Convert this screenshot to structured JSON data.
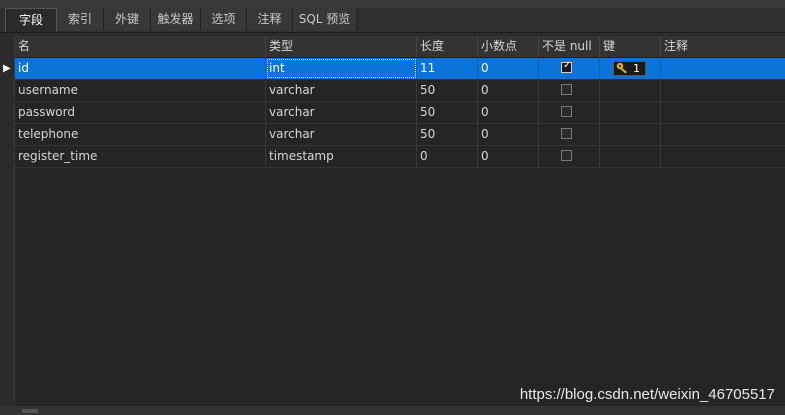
{
  "tabs": [
    {
      "label": "字段",
      "active": true
    },
    {
      "label": "索引",
      "active": false
    },
    {
      "label": "外键",
      "active": false
    },
    {
      "label": "触发器",
      "active": false
    },
    {
      "label": "选项",
      "active": false
    },
    {
      "label": "注释",
      "active": false
    },
    {
      "label": "SQL 预览",
      "active": false
    }
  ],
  "columns": [
    "名",
    "类型",
    "长度",
    "小数点",
    "不是 null",
    "键",
    "注释"
  ],
  "rows": [
    {
      "name": "id",
      "type": "int",
      "length": "11",
      "decimals": "0",
      "not_null": true,
      "key": "1",
      "comment": ""
    },
    {
      "name": "username",
      "type": "varchar",
      "length": "50",
      "decimals": "0",
      "not_null": false,
      "key": "",
      "comment": ""
    },
    {
      "name": "password",
      "type": "varchar",
      "length": "50",
      "decimals": "0",
      "not_null": false,
      "key": "",
      "comment": ""
    },
    {
      "name": "telephone",
      "type": "varchar",
      "length": "50",
      "decimals": "0",
      "not_null": false,
      "key": "",
      "comment": ""
    },
    {
      "name": "register_time",
      "type": "timestamp",
      "length": "0",
      "decimals": "0",
      "not_null": false,
      "key": "",
      "comment": ""
    }
  ],
  "selected_row_index": 0,
  "icons": {
    "key_icon": "key-icon",
    "row_marker": "row-pointer-icon",
    "checkmark": "checkmark-icon"
  },
  "colors": {
    "selection": "#0a74da",
    "key_icon": "#e6b422",
    "background": "#252525"
  },
  "watermark": "https://blog.csdn.net/weixin_46705517"
}
